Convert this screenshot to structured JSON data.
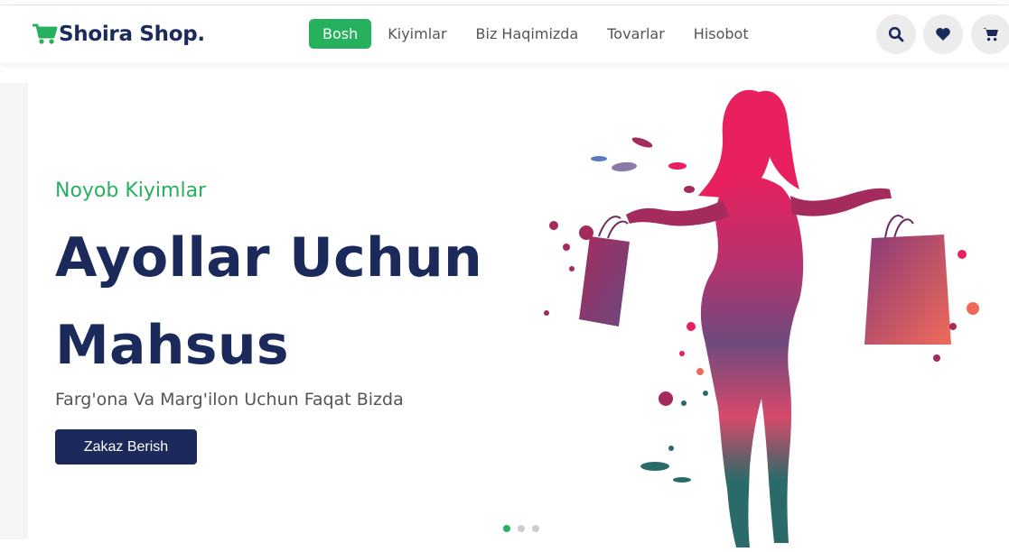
{
  "brand": {
    "name": "Shoira Shop.",
    "icon": "cart-icon",
    "icon_color": "#27b05e"
  },
  "nav": {
    "items": [
      {
        "label": "Bosh",
        "active": true
      },
      {
        "label": "Kiyimlar",
        "active": false
      },
      {
        "label": "Biz Haqimizda",
        "active": false
      },
      {
        "label": "Tovarlar",
        "active": false
      },
      {
        "label": "Hisobot",
        "active": false
      }
    ]
  },
  "header_actions": [
    {
      "icon": "search-icon"
    },
    {
      "icon": "heart-icon"
    },
    {
      "icon": "cart-icon"
    }
  ],
  "hero": {
    "eyebrow": "Noyob Kiyimlar",
    "headline": "Ayollar Uchun Mahsus",
    "subtext": "Farg'ona Va Marg'ilon Uchun Faqat Bizda",
    "cta_label": "Zakaz Berish",
    "image": "woman-with-shopping-bags-illustration",
    "slides": [
      {
        "active": true
      },
      {
        "active": false
      },
      {
        "active": false
      }
    ]
  },
  "colors": {
    "accent": "#27b05e",
    "primary": "#1b2a5a",
    "text_muted": "#555555",
    "icon_button_bg": "#ececec"
  }
}
